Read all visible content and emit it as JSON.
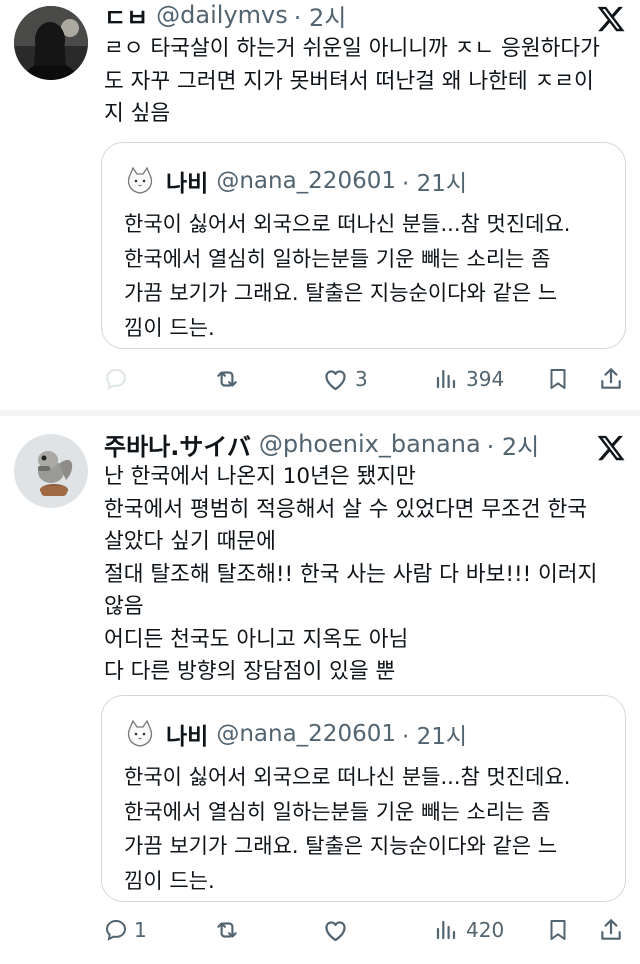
{
  "posts": [
    {
      "display_name": "ㄷㅂ",
      "handle": "@dailymvs",
      "time": "· 2시",
      "body_lines": [
        "ㄹㅇ 타국살이 하는거 쉬운일 아니니까 ㅈㄴ 응원하다가",
        "도 자꾸 그러면 지가 못버텨서 떠난걸 왜 나한테 ㅈㄹ이",
        "지 싶음"
      ],
      "quote": {
        "display_name": "나비",
        "handle": "@nana_220601",
        "time": "· 21시",
        "body_lines": [
          "한국이 싫어서 외국으로 떠나신 분들...참 멋진데요.",
          "한국에서 열심히 일하는분들 기운 빼는 소리는 좀",
          "가끔 보기가 그래요. 탈출은 지능순이다와 같은 느",
          "낌이 드는."
        ]
      },
      "actions": {
        "reply_count": "",
        "retweet_count": "",
        "like_count": "3",
        "views_count": "394"
      }
    },
    {
      "display_name": "주바나.サイバ",
      "handle": "@phoenix_banana",
      "time": "· 2시",
      "body_lines": [
        "난 한국에서 나온지 10년은 됐지만",
        "한국에서 평범히 적응해서 살 수 있었다면 무조건 한국",
        "살았다 싶기 때문에",
        "절대 탈조해 탈조해!! 한국 사는 사람 다 바보!!! 이러지",
        "않음",
        "어디든 천국도 아니고 지옥도 아님",
        "다 다른 방향의 장담점이 있을 뿐"
      ],
      "quote": {
        "display_name": "나비",
        "handle": "@nana_220601",
        "time": "· 21시",
        "body_lines": [
          "한국이 싫어서 외국으로 떠나신 분들...참 멋진데요.",
          "한국에서 열심히 일하는분들 기운 빼는 소리는 좀",
          "가끔 보기가 그래요. 탈출은 지능순이다와 같은 느",
          "낌이 드는."
        ]
      },
      "actions": {
        "reply_count": "1",
        "retweet_count": "",
        "like_count": "",
        "views_count": "420"
      }
    }
  ],
  "icons": {
    "platform": "x-logo-icon",
    "reply": "reply-bubble-icon",
    "retweet": "retweet-icon",
    "like": "heart-icon",
    "views": "views-bar-chart-icon",
    "bookmark": "bookmark-icon",
    "share": "share-icon",
    "quote_avatar": "white-cat-avatar-icon"
  },
  "colors": {
    "text": "#0f1419",
    "secondary": "#536471",
    "border": "#cfd9de",
    "divider": "#f1f3f4"
  }
}
